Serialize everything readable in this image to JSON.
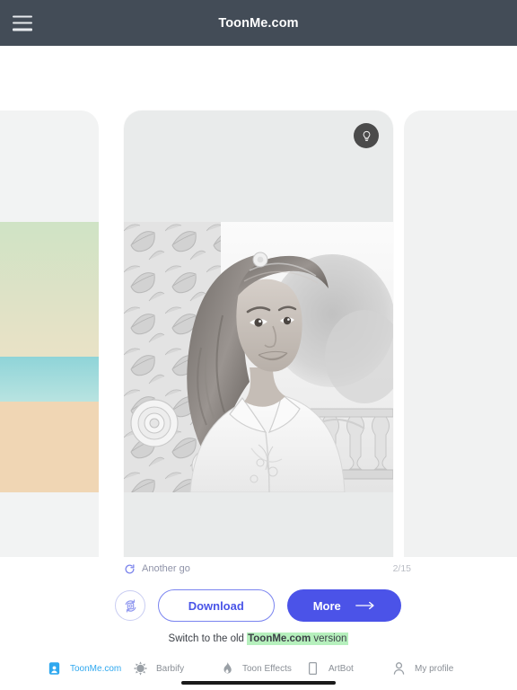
{
  "header": {
    "title": "ToonMe.com",
    "menu_icon": "hamburger-icon"
  },
  "carousel": {
    "counter": "2/15",
    "idea_button_icon": "lightbulb-icon",
    "cards": [
      {
        "position": "previous",
        "style": "color-illustration",
        "alt": "Color cartoon portrait preview"
      },
      {
        "position": "current",
        "style": "pencil-sketch",
        "alt": "Grayscale pencil sketch portrait of a smiling woman with long wavy hair in a white blouse, roses and foliage at left, balustrade and trees at right"
      },
      {
        "position": "next",
        "style": "empty-placeholder",
        "alt": "Next result placeholder"
      }
    ]
  },
  "actions": {
    "another_go_label": "Another go",
    "another_go_icon": "refresh-icon",
    "shuffle_icon": "swap-face-icon",
    "download_label": "Download",
    "more_label": "More",
    "more_arrow_icon": "arrow-right-icon"
  },
  "switch_banner": {
    "prefix": "Switch to the old ",
    "brand": "ToonMe.com",
    "suffix": " version",
    "highlight_color": "#b6f0bd"
  },
  "bottom_nav": {
    "items": [
      {
        "label": "ToonMe.com",
        "icon": "toonme-portrait-icon",
        "active": true
      },
      {
        "label": "Barbify",
        "icon": "starburst-icon",
        "active": false
      },
      {
        "label": "Toon Effects",
        "icon": "flame-icon",
        "active": false
      },
      {
        "label": "ArtBot",
        "icon": "frame-icon",
        "active": false
      },
      {
        "label": "My profile",
        "icon": "person-icon",
        "active": false
      }
    ]
  },
  "colors": {
    "header_bg": "#434c57",
    "accent_blue": "#4b53e8",
    "accent_cyan": "#2fa8ef",
    "card_bg": "#e9ebeb",
    "muted_text": "#8a8f96"
  }
}
